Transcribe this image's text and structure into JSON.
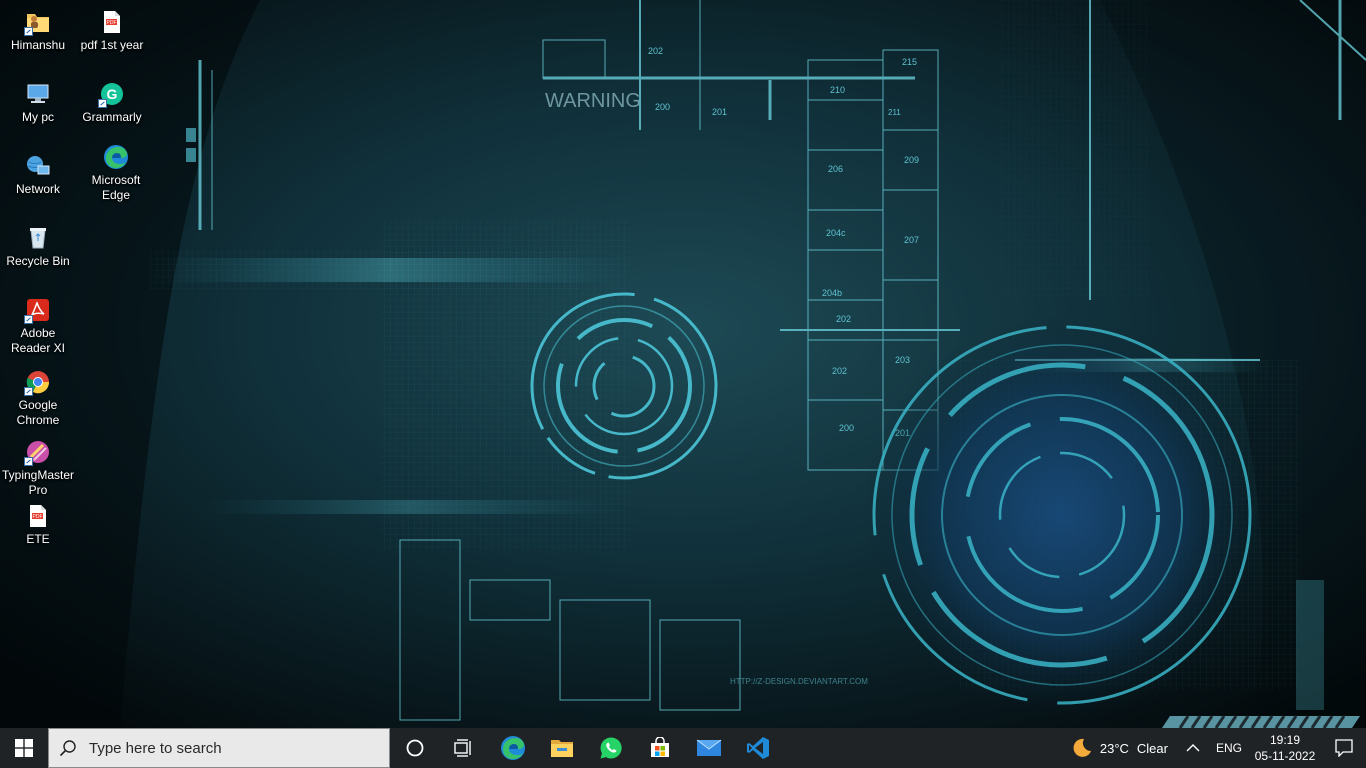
{
  "wallpaper": {
    "warning_text": "WARNING",
    "room_labels": [
      "202",
      "200",
      "201",
      "210",
      "211",
      "215",
      "206",
      "209",
      "204c",
      "207",
      "204b",
      "202",
      "203",
      "202",
      "200",
      "201"
    ],
    "url_text": "HTTP://Z-DESIGN.DEVIANTART.COM"
  },
  "desktop": {
    "icons": [
      {
        "label": "Himanshu",
        "icon": "user-folder-icon"
      },
      {
        "label": "pdf 1st year",
        "icon": "pdf-file-icon"
      },
      {
        "label": "My pc",
        "icon": "computer-icon"
      },
      {
        "label": "Grammarly",
        "icon": "grammarly-icon"
      },
      {
        "label": "Network",
        "icon": "network-icon"
      },
      {
        "label": "Microsoft Edge",
        "icon": "edge-icon"
      },
      {
        "label": "Recycle Bin",
        "icon": "recycle-bin-icon"
      },
      {
        "label": "Adobe Reader XI",
        "icon": "adobe-reader-icon"
      },
      {
        "label": "Google Chrome",
        "icon": "chrome-icon"
      },
      {
        "label": "TypingMaster Pro",
        "icon": "typingmaster-icon"
      },
      {
        "label": "ETE",
        "icon": "pdf-file-icon"
      }
    ]
  },
  "taskbar": {
    "search_placeholder": "Type here to search",
    "pinned": [
      "cortana-icon",
      "task-view-icon",
      "edge-icon",
      "file-explorer-icon",
      "whatsapp-icon",
      "microsoft-store-icon",
      "mail-icon",
      "vscode-icon"
    ],
    "weather": {
      "temp": "23°C",
      "condition": "Clear"
    },
    "language": "ENG",
    "time": "19:19",
    "date": "05-11-2022"
  },
  "colors": {
    "taskbar_bg": "#1f2326",
    "accent_cyan": "#2fb8c8",
    "start_blue": "#ffffff"
  }
}
